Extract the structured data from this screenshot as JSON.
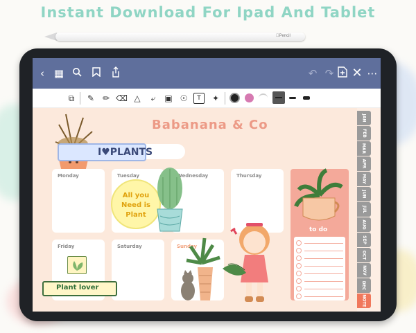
{
  "headline": "Instant Download For Ipad And Tablet",
  "pencil_brand": "Pencil",
  "navbar": {
    "icons": [
      "back-icon",
      "grid-icon",
      "search-icon",
      "bookmark-icon",
      "share-icon",
      "undo-icon",
      "redo-icon",
      "add-page-icon",
      "close-icon",
      "more-icon"
    ]
  },
  "toolbar": {
    "tools": [
      "lasso-select-icon",
      "pen-icon",
      "pencil-icon",
      "eraser-icon",
      "shapes-icon",
      "lasso-icon",
      "image-icon",
      "camera-icon",
      "text-icon",
      "pointer-icon"
    ],
    "colors": [
      "#222222",
      "#d67ab1",
      "#cfcfcf",
      "#555555"
    ]
  },
  "planner": {
    "brand": "Babanana & Co",
    "plants_tag": "I♥PLANTS",
    "days": [
      "Monday",
      "Tuesday",
      "Wednesday",
      "Thursday",
      "Friday",
      "Saturday",
      "Sunday"
    ],
    "bubble": "All you Need is Plant",
    "plant_lover": "Plant lover",
    "todo_title": "to do",
    "todo_rows": 8
  },
  "tabs": [
    "JAN",
    "FEB",
    "MAR",
    "APR",
    "MAY",
    "JUN",
    "JUL",
    "AUG",
    "SEP",
    "OCT",
    "NOV",
    "DEC",
    "NOTE"
  ]
}
